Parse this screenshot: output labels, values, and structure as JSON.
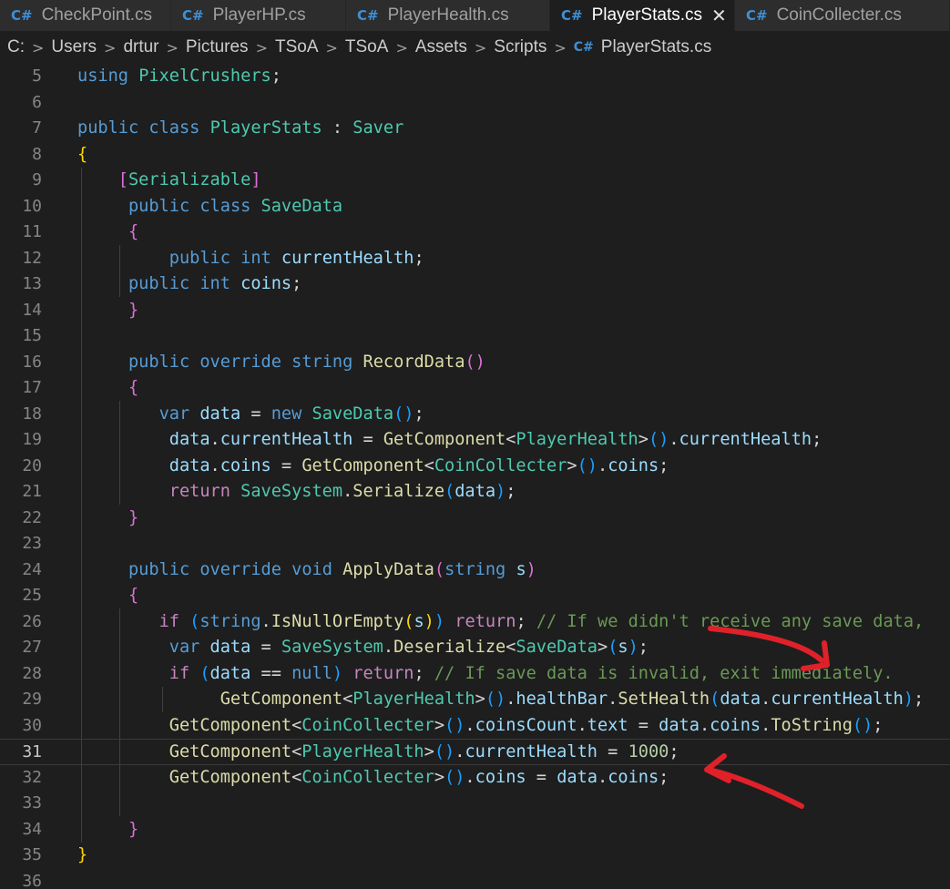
{
  "tabs": [
    {
      "name": "CheckPoint.cs",
      "active": false
    },
    {
      "name": "PlayerHP.cs",
      "active": false
    },
    {
      "name": "PlayerHealth.cs",
      "active": false
    },
    {
      "name": "PlayerStats.cs",
      "active": true
    },
    {
      "name": "CoinCollecter.cs",
      "active": false
    }
  ],
  "tab_icon_glyph": "C#",
  "tab_close_glyph": "✕",
  "breadcrumb": [
    "C:",
    "Users",
    "drtur",
    "Pictures",
    "TSoA",
    "TSoA",
    "Assets",
    "Scripts",
    "PlayerStats.cs"
  ],
  "breadcrumb_separator": ">",
  "current_line": 31,
  "colors": {
    "editor_bg": "#1e1e1e",
    "keyword": "#569cd6",
    "type": "#4ec9b0",
    "variable": "#9cdcfe",
    "method": "#dcdcaa",
    "comment": "#6a9955",
    "number": "#b5cea8",
    "annotation_arrow": "#e0212a"
  },
  "lines": [
    {
      "n": 5,
      "tokens": [
        [
          "k",
          "using"
        ],
        [
          "p",
          " "
        ],
        [
          "t",
          "PixelCrushers"
        ],
        [
          "p",
          ";"
        ]
      ]
    },
    {
      "n": 6,
      "tokens": []
    },
    {
      "n": 7,
      "tokens": [
        [
          "k",
          "public"
        ],
        [
          "p",
          " "
        ],
        [
          "k",
          "class"
        ],
        [
          "p",
          " "
        ],
        [
          "t",
          "PlayerStats"
        ],
        [
          "p",
          " : "
        ],
        [
          "t",
          "Saver"
        ]
      ]
    },
    {
      "n": 8,
      "tokens": [
        [
          "b1",
          "{"
        ]
      ]
    },
    {
      "n": 9,
      "tokens": [
        [
          "p",
          "    "
        ],
        [
          "b2",
          "["
        ],
        [
          "t",
          "Serializable"
        ],
        [
          "b2",
          "]"
        ]
      ]
    },
    {
      "n": 10,
      "tokens": [
        [
          "p",
          "     "
        ],
        [
          "k",
          "public"
        ],
        [
          "p",
          " "
        ],
        [
          "k",
          "class"
        ],
        [
          "p",
          " "
        ],
        [
          "t",
          "SaveData"
        ]
      ]
    },
    {
      "n": 11,
      "tokens": [
        [
          "p",
          "     "
        ],
        [
          "b2",
          "{"
        ]
      ]
    },
    {
      "n": 12,
      "tokens": [
        [
          "p",
          "         "
        ],
        [
          "k",
          "public"
        ],
        [
          "p",
          " "
        ],
        [
          "k",
          "int"
        ],
        [
          "p",
          " "
        ],
        [
          "v",
          "currentHealth"
        ],
        [
          "p",
          ";"
        ]
      ]
    },
    {
      "n": 13,
      "tokens": [
        [
          "p",
          "     "
        ],
        [
          "k",
          "public"
        ],
        [
          "p",
          " "
        ],
        [
          "k",
          "int"
        ],
        [
          "p",
          " "
        ],
        [
          "v",
          "coins"
        ],
        [
          "p",
          ";"
        ]
      ]
    },
    {
      "n": 14,
      "tokens": [
        [
          "p",
          "     "
        ],
        [
          "b2",
          "}"
        ]
      ]
    },
    {
      "n": 15,
      "tokens": []
    },
    {
      "n": 16,
      "tokens": [
        [
          "p",
          "     "
        ],
        [
          "k",
          "public"
        ],
        [
          "p",
          " "
        ],
        [
          "k",
          "override"
        ],
        [
          "p",
          " "
        ],
        [
          "k",
          "string"
        ],
        [
          "p",
          " "
        ],
        [
          "m",
          "RecordData"
        ],
        [
          "b2",
          "()"
        ]
      ]
    },
    {
      "n": 17,
      "tokens": [
        [
          "p",
          "     "
        ],
        [
          "b2",
          "{"
        ]
      ]
    },
    {
      "n": 18,
      "tokens": [
        [
          "p",
          "        "
        ],
        [
          "k",
          "var"
        ],
        [
          "p",
          " "
        ],
        [
          "v",
          "data"
        ],
        [
          "p",
          " = "
        ],
        [
          "k",
          "new"
        ],
        [
          "p",
          " "
        ],
        [
          "t",
          "SaveData"
        ],
        [
          "b3",
          "()"
        ],
        [
          "p",
          ";"
        ]
      ]
    },
    {
      "n": 19,
      "tokens": [
        [
          "p",
          "         "
        ],
        [
          "v",
          "data"
        ],
        [
          "p",
          "."
        ],
        [
          "v",
          "currentHealth"
        ],
        [
          "p",
          " = "
        ],
        [
          "m",
          "GetComponent"
        ],
        [
          "p",
          "<"
        ],
        [
          "t",
          "PlayerHealth"
        ],
        [
          "p",
          ">"
        ],
        [
          "b3",
          "()"
        ],
        [
          "p",
          "."
        ],
        [
          "v",
          "currentHealth"
        ],
        [
          "p",
          ";"
        ]
      ]
    },
    {
      "n": 20,
      "tokens": [
        [
          "p",
          "         "
        ],
        [
          "v",
          "data"
        ],
        [
          "p",
          "."
        ],
        [
          "v",
          "coins"
        ],
        [
          "p",
          " = "
        ],
        [
          "m",
          "GetComponent"
        ],
        [
          "p",
          "<"
        ],
        [
          "t",
          "CoinCollecter"
        ],
        [
          "p",
          ">"
        ],
        [
          "b3",
          "()"
        ],
        [
          "p",
          "."
        ],
        [
          "v",
          "coins"
        ],
        [
          "p",
          ";"
        ]
      ]
    },
    {
      "n": 21,
      "tokens": [
        [
          "p",
          "         "
        ],
        [
          "c",
          "return"
        ],
        [
          "p",
          " "
        ],
        [
          "t",
          "SaveSystem"
        ],
        [
          "p",
          "."
        ],
        [
          "m",
          "Serialize"
        ],
        [
          "b3",
          "("
        ],
        [
          "v",
          "data"
        ],
        [
          "b3",
          ")"
        ],
        [
          "p",
          ";"
        ]
      ]
    },
    {
      "n": 22,
      "tokens": [
        [
          "p",
          "     "
        ],
        [
          "b2",
          "}"
        ]
      ]
    },
    {
      "n": 23,
      "tokens": []
    },
    {
      "n": 24,
      "tokens": [
        [
          "p",
          "     "
        ],
        [
          "k",
          "public"
        ],
        [
          "p",
          " "
        ],
        [
          "k",
          "override"
        ],
        [
          "p",
          " "
        ],
        [
          "k",
          "void"
        ],
        [
          "p",
          " "
        ],
        [
          "m",
          "ApplyData"
        ],
        [
          "b2",
          "("
        ],
        [
          "k",
          "string"
        ],
        [
          "p",
          " "
        ],
        [
          "v",
          "s"
        ],
        [
          "b2",
          ")"
        ]
      ]
    },
    {
      "n": 25,
      "tokens": [
        [
          "p",
          "     "
        ],
        [
          "b2",
          "{"
        ]
      ]
    },
    {
      "n": 26,
      "tokens": [
        [
          "p",
          "        "
        ],
        [
          "c",
          "if"
        ],
        [
          "p",
          " "
        ],
        [
          "b3",
          "("
        ],
        [
          "k",
          "string"
        ],
        [
          "p",
          "."
        ],
        [
          "m",
          "IsNullOrEmpty"
        ],
        [
          "b1",
          "("
        ],
        [
          "v",
          "s"
        ],
        [
          "b1",
          ")"
        ],
        [
          "b3",
          ")"
        ],
        [
          "p",
          " "
        ],
        [
          "c",
          "return"
        ],
        [
          "p",
          "; "
        ],
        [
          "s",
          "// If we didn't receive any save data,"
        ]
      ]
    },
    {
      "n": 27,
      "tokens": [
        [
          "p",
          "         "
        ],
        [
          "k",
          "var"
        ],
        [
          "p",
          " "
        ],
        [
          "v",
          "data"
        ],
        [
          "p",
          " = "
        ],
        [
          "t",
          "SaveSystem"
        ],
        [
          "p",
          "."
        ],
        [
          "m",
          "Deserialize"
        ],
        [
          "p",
          "<"
        ],
        [
          "t",
          "SaveData"
        ],
        [
          "p",
          ">"
        ],
        [
          "b3",
          "("
        ],
        [
          "v",
          "s"
        ],
        [
          "b3",
          ")"
        ],
        [
          "p",
          ";"
        ]
      ]
    },
    {
      "n": 28,
      "tokens": [
        [
          "p",
          "         "
        ],
        [
          "c",
          "if"
        ],
        [
          "p",
          " "
        ],
        [
          "b3",
          "("
        ],
        [
          "v",
          "data"
        ],
        [
          "p",
          " == "
        ],
        [
          "k",
          "null"
        ],
        [
          "b3",
          ")"
        ],
        [
          "p",
          " "
        ],
        [
          "c",
          "return"
        ],
        [
          "p",
          "; "
        ],
        [
          "s",
          "// If save data is invalid, exit immediately."
        ]
      ]
    },
    {
      "n": 29,
      "tokens": [
        [
          "p",
          "              "
        ],
        [
          "m",
          "GetComponent"
        ],
        [
          "p",
          "<"
        ],
        [
          "t",
          "PlayerHealth"
        ],
        [
          "p",
          ">"
        ],
        [
          "b3",
          "()"
        ],
        [
          "p",
          "."
        ],
        [
          "v",
          "healthBar"
        ],
        [
          "p",
          "."
        ],
        [
          "m",
          "SetHealth"
        ],
        [
          "b3",
          "("
        ],
        [
          "v",
          "data"
        ],
        [
          "p",
          "."
        ],
        [
          "v",
          "currentHealth"
        ],
        [
          "b3",
          ")"
        ],
        [
          "p",
          ";"
        ]
      ]
    },
    {
      "n": 30,
      "tokens": [
        [
          "p",
          "         "
        ],
        [
          "m",
          "GetComponent"
        ],
        [
          "p",
          "<"
        ],
        [
          "t",
          "CoinCollecter"
        ],
        [
          "p",
          ">"
        ],
        [
          "b3",
          "()"
        ],
        [
          "p",
          "."
        ],
        [
          "v",
          "coinsCount"
        ],
        [
          "p",
          "."
        ],
        [
          "v",
          "text"
        ],
        [
          "p",
          " = "
        ],
        [
          "v",
          "data"
        ],
        [
          "p",
          "."
        ],
        [
          "v",
          "coins"
        ],
        [
          "p",
          "."
        ],
        [
          "m",
          "ToString"
        ],
        [
          "b3",
          "()"
        ],
        [
          "p",
          ";"
        ]
      ]
    },
    {
      "n": 31,
      "tokens": [
        [
          "p",
          "         "
        ],
        [
          "m",
          "GetComponent"
        ],
        [
          "p",
          "<"
        ],
        [
          "t",
          "PlayerHealth"
        ],
        [
          "p",
          ">"
        ],
        [
          "b3",
          "()"
        ],
        [
          "p",
          "."
        ],
        [
          "v",
          "currentHealth"
        ],
        [
          "p",
          " = "
        ],
        [
          "n",
          "1000"
        ],
        [
          "p",
          ";"
        ]
      ]
    },
    {
      "n": 32,
      "tokens": [
        [
          "p",
          "         "
        ],
        [
          "m",
          "GetComponent"
        ],
        [
          "p",
          "<"
        ],
        [
          "t",
          "CoinCollecter"
        ],
        [
          "p",
          ">"
        ],
        [
          "b3",
          "()"
        ],
        [
          "p",
          "."
        ],
        [
          "v",
          "coins"
        ],
        [
          "p",
          " = "
        ],
        [
          "v",
          "data"
        ],
        [
          "p",
          "."
        ],
        [
          "v",
          "coins"
        ],
        [
          "p",
          ";"
        ]
      ]
    },
    {
      "n": 33,
      "tokens": []
    },
    {
      "n": 34,
      "tokens": [
        [
          "p",
          "     "
        ],
        [
          "b2",
          "}"
        ]
      ]
    },
    {
      "n": 35,
      "tokens": [
        [
          "b1",
          "}"
        ]
      ]
    },
    {
      "n": 36,
      "tokens": []
    }
  ]
}
